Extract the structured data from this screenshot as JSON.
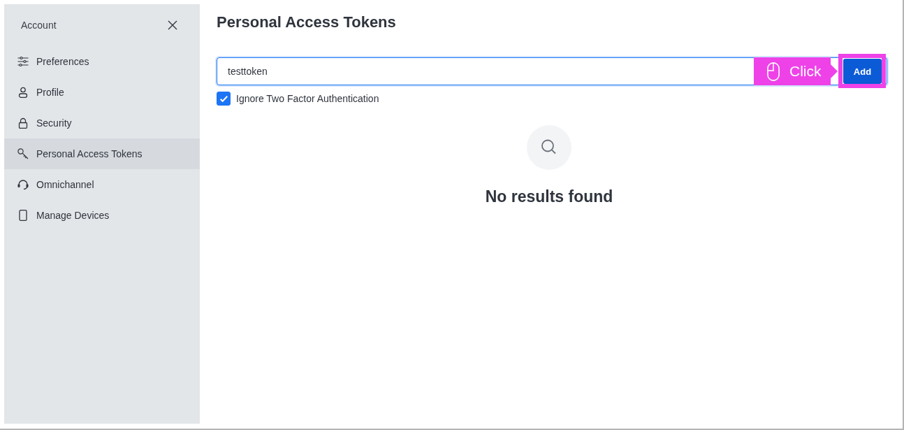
{
  "sidebar": {
    "title": "Account",
    "items": [
      {
        "label": "Preferences",
        "selected": false
      },
      {
        "label": "Profile",
        "selected": false
      },
      {
        "label": "Security",
        "selected": false
      },
      {
        "label": "Personal Access Tokens",
        "selected": true
      },
      {
        "label": "Omnichannel",
        "selected": false
      },
      {
        "label": "Manage Devices",
        "selected": false
      }
    ]
  },
  "main": {
    "title": "Personal Access Tokens",
    "token_field": {
      "value": "testtoken",
      "focused": true
    },
    "add_button": {
      "label": "Add"
    },
    "ignore_two_factor": {
      "label": "Ignore Two Factor Authentication",
      "checked": true
    },
    "empty_state": {
      "message": "No results found"
    }
  },
  "tutorial_overlay": {
    "callout": "Click"
  }
}
